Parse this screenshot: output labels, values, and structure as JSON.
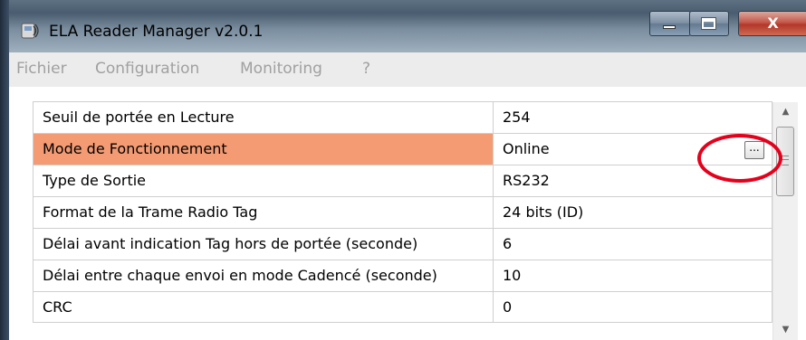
{
  "window": {
    "title": "ELA Reader Manager v2.0.1",
    "close_label": "X"
  },
  "menu": [
    "Fichier",
    "Configuration",
    "Monitoring",
    "?"
  ],
  "properties": [
    {
      "label": "Seuil de portée en Lecture",
      "value": "254",
      "selected": false
    },
    {
      "label": "Mode de Fonctionnement",
      "value": "Online",
      "selected": true,
      "button": "..."
    },
    {
      "label": "Type de Sortie",
      "value": "RS232",
      "selected": false
    },
    {
      "label": "Format de la Trame Radio Tag",
      "value": "24 bits (ID)",
      "selected": false
    },
    {
      "label": "Délai avant indication Tag hors de portée (seconde)",
      "value": "6",
      "selected": false
    },
    {
      "label": "Délai entre chaque envoi en mode Cadencé (seconde)",
      "value": "10",
      "selected": false
    },
    {
      "label": "CRC",
      "value": "0",
      "selected": false
    }
  ],
  "colors": {
    "selected_row": "#f59b73",
    "highlight_ring": "#e5001b"
  },
  "icons": {
    "app": "ela-app-icon",
    "minimize": "minimize-icon",
    "maximize": "maximize-icon",
    "close": "close-icon",
    "scroll_up": "scroll-up-arrow-icon",
    "scroll_down": "scroll-down-arrow-icon"
  }
}
